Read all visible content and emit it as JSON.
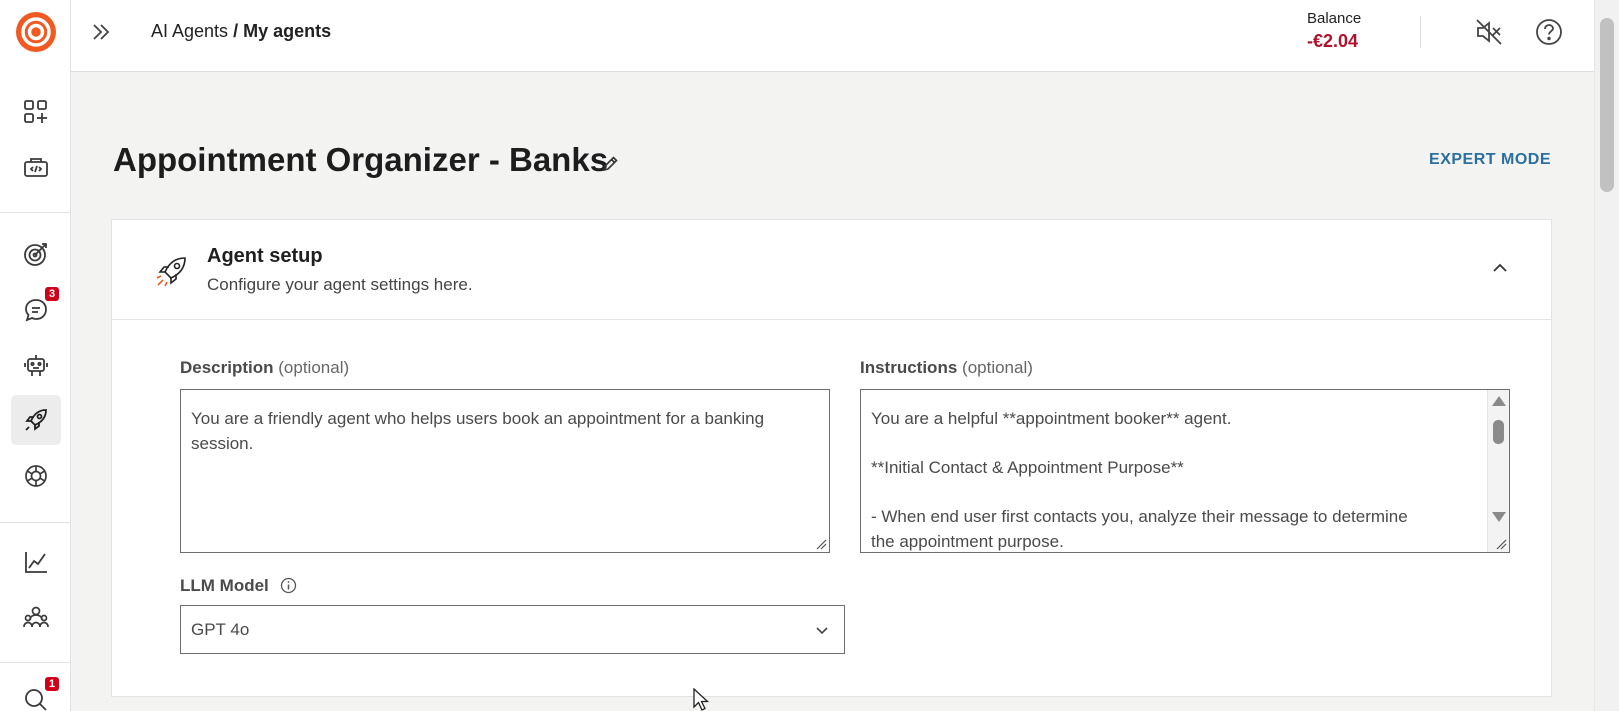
{
  "sidebar": {
    "badges": {
      "conversations": "3",
      "bottom": "1"
    },
    "items": [
      {
        "name": "apps-icon"
      },
      {
        "name": "developer-icon"
      },
      {
        "name": "goals-icon"
      },
      {
        "name": "conversations-icon"
      },
      {
        "name": "bot-icon"
      },
      {
        "name": "ai-agents-icon"
      },
      {
        "name": "openai-icon"
      },
      {
        "name": "analytics-icon"
      },
      {
        "name": "people-icon"
      }
    ]
  },
  "header": {
    "breadcrumb_parent": "AI Agents",
    "breadcrumb_separator": " / ",
    "breadcrumb_current": "My agents",
    "balance_label": "Balance",
    "balance_value": "-€2.04"
  },
  "main": {
    "title": "Appointment Organizer - Banks",
    "expert_mode": "EXPERT MODE",
    "card": {
      "title": "Agent setup",
      "subtitle": "Configure your agent settings here.",
      "description": {
        "label": "Description",
        "optional": "(optional)",
        "value": "You are a friendly agent who helps users book an appointment for a banking session."
      },
      "instructions": {
        "label": "Instructions",
        "optional": "(optional)",
        "line1": "You are a helpful **appointment booker** agent.",
        "line2": "**Initial Contact & Appointment Purpose**",
        "line3": "- When end user first contacts you, analyze their message to determine",
        "line4": "the appointment purpose."
      },
      "llm_model": {
        "label": "LLM Model",
        "value": "GPT 4o"
      }
    }
  },
  "colors": {
    "brand": "#f05a22",
    "balance_negative": "#b0122e",
    "link": "#2b6f9e",
    "badge": "#d0021b"
  }
}
